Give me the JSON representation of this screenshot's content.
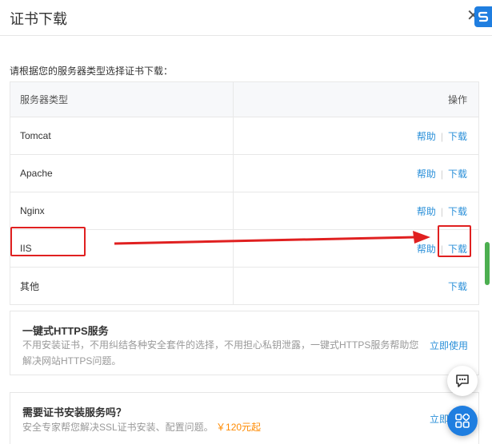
{
  "header": {
    "title": "证书下载",
    "close_glyph": "✕"
  },
  "intro": "请根据您的服务器类型选择证书下载：",
  "table": {
    "headers": [
      "服务器类型",
      "操作"
    ],
    "rows": [
      {
        "server": "Tomcat",
        "help": "帮助",
        "download": "下载"
      },
      {
        "server": "Apache",
        "help": "帮助",
        "download": "下载"
      },
      {
        "server": "Nginx",
        "help": "帮助",
        "download": "下载"
      },
      {
        "server": "IIS",
        "help": "帮助",
        "download": "下载"
      },
      {
        "server": "其他",
        "download": "下载"
      }
    ]
  },
  "promo_https": {
    "title": "一键式HTTPS服务",
    "desc": "不用安装证书，不用纠结各种安全套件的选择，不用担心私钥泄露，一键式HTTPS服务帮助您解决网站HTTPS问题。",
    "action": "立即使用"
  },
  "promo_install": {
    "title": "需要证书安装服务吗？",
    "desc": "安全专家帮您解决SSL证书安装、配置问题。",
    "price": "￥120元起",
    "action": "立即"
  },
  "colors": {
    "link": "#2b90d9",
    "annotation": "#e02020",
    "price": "#ff8a00",
    "accent": "#1f7ee0"
  },
  "icons": {
    "top_badge": "brand-s-icon",
    "chat": "chat-icon",
    "grid": "grid-icon"
  }
}
